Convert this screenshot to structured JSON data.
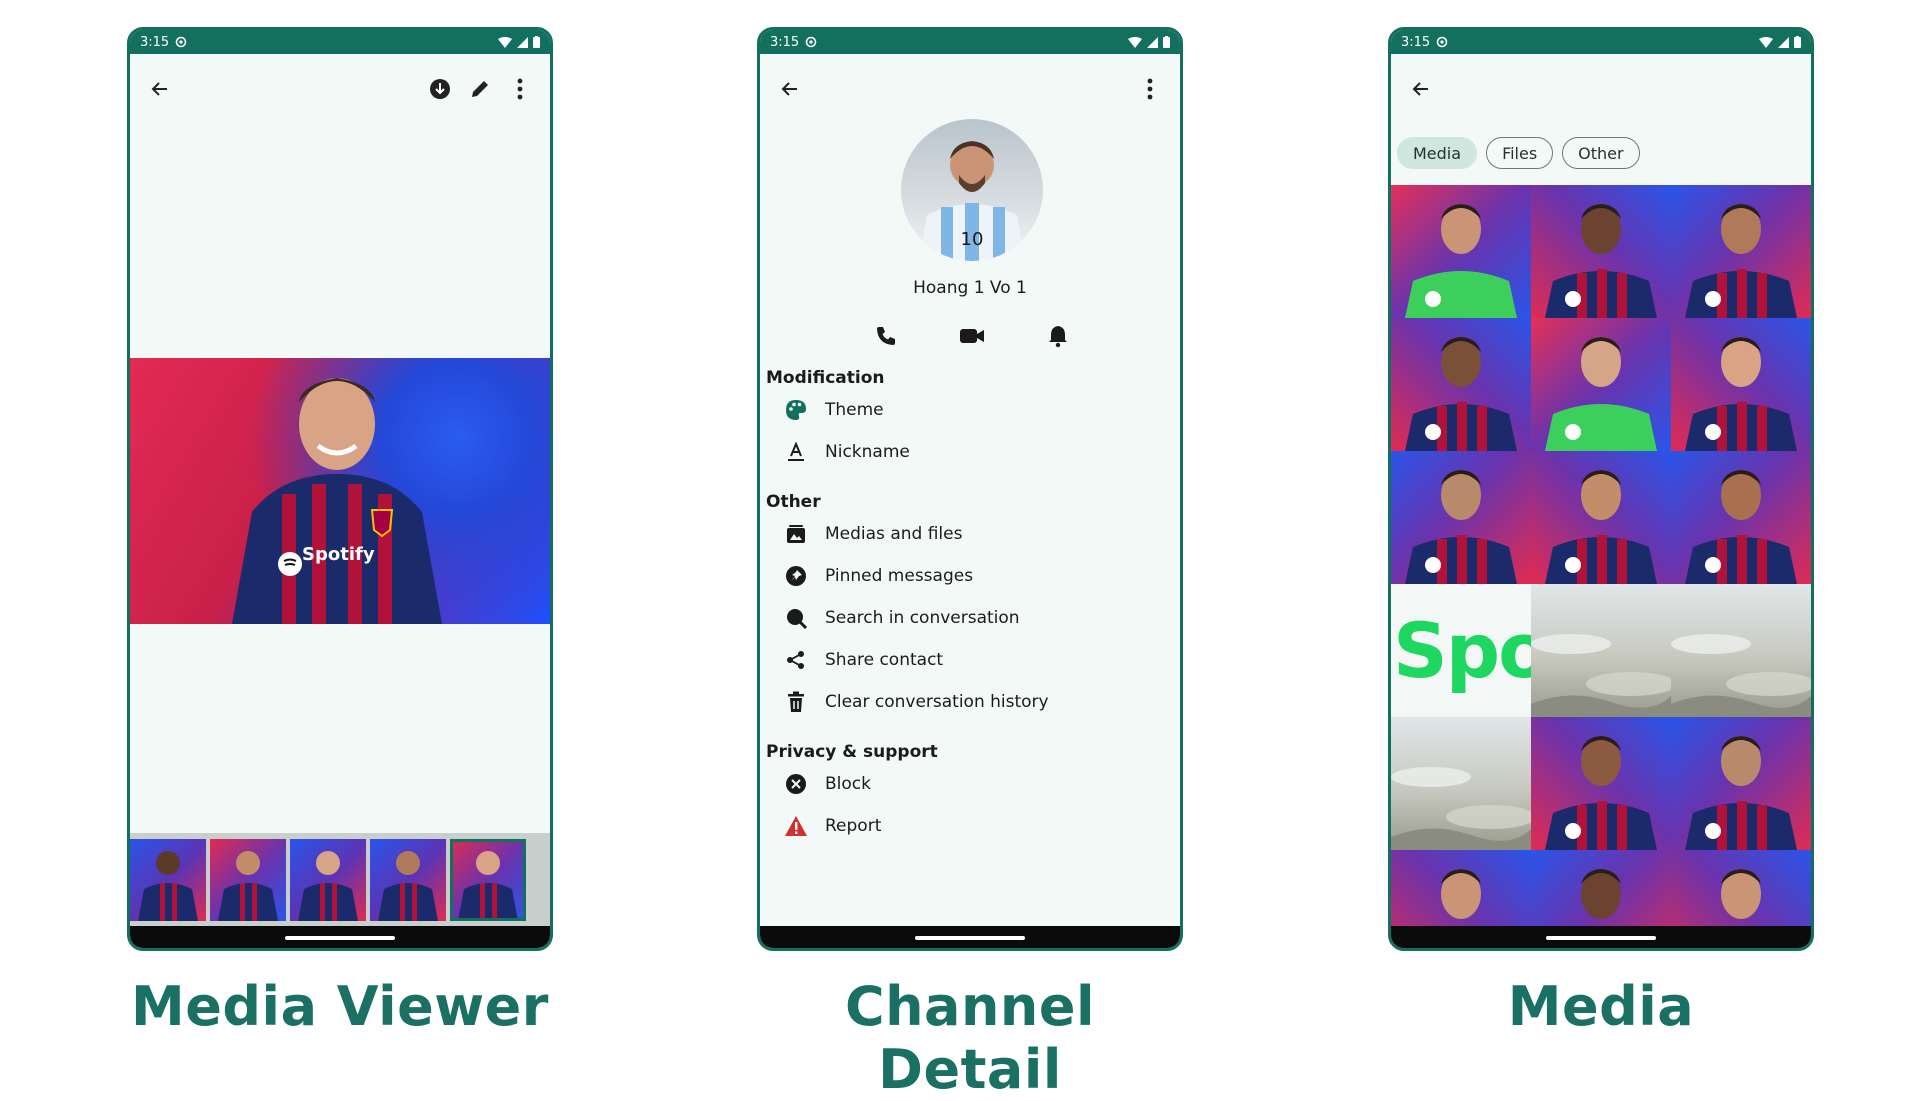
{
  "status": {
    "time": "3:15"
  },
  "media_viewer": {
    "caption": "Media Viewer",
    "photo_sponsor": "Spotify",
    "thumbnail_count": 5,
    "selected_thumbnail_index": 4
  },
  "channel_detail": {
    "caption": "Channel Detail",
    "contact_name": "Hoang 1 Vo 1",
    "avatar_number": "10",
    "sections": [
      {
        "title": "Modification",
        "items": [
          {
            "label": "Theme",
            "icon": "palette-icon"
          },
          {
            "label": "Nickname",
            "icon": "font-icon"
          }
        ]
      },
      {
        "title": "Other",
        "items": [
          {
            "label": "Medias and files",
            "icon": "gallery-icon"
          },
          {
            "label": "Pinned messages",
            "icon": "pin-icon"
          },
          {
            "label": "Search in conversation",
            "icon": "search-icon"
          },
          {
            "label": "Share contact",
            "icon": "share-icon"
          },
          {
            "label": "Clear conversation history",
            "icon": "trash-icon"
          }
        ]
      },
      {
        "title": "Privacy & support",
        "items": [
          {
            "label": "Block",
            "icon": "block-icon"
          },
          {
            "label": "Report",
            "icon": "warning-icon"
          }
        ]
      }
    ]
  },
  "media_screen": {
    "caption": "Media",
    "tabs": [
      "Media",
      "Files",
      "Other"
    ],
    "active_tab": "Media",
    "grid_text": "Spo"
  },
  "colors": {
    "primary": "#14705e",
    "caption": "#1a7062",
    "background": "#f3f9f7",
    "report_red": "#d32f2f"
  }
}
